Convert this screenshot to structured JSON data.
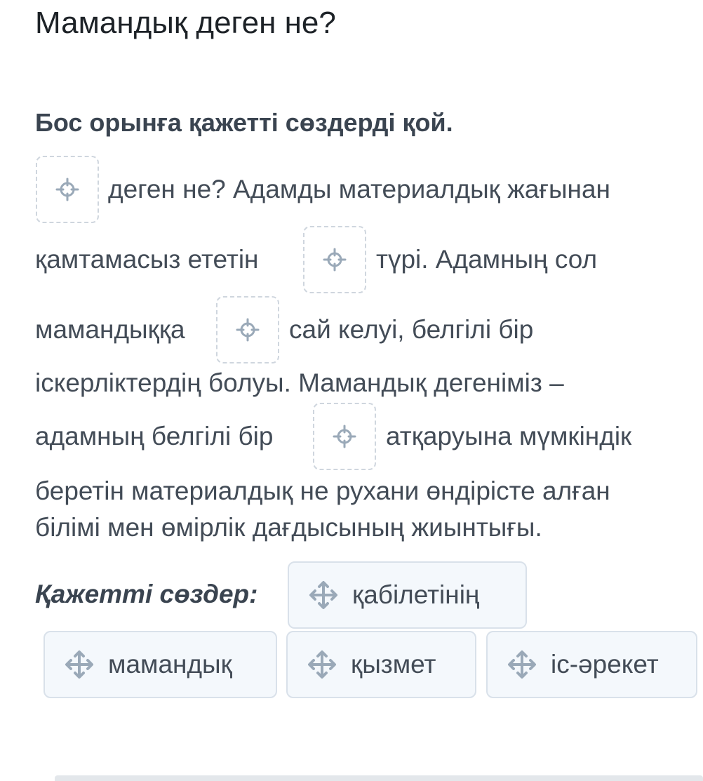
{
  "title": "Мамандық деген не?",
  "instruction": "Бос орынға қажетті сөздерді қой.",
  "text_lines": {
    "l1": "деген не? Адамды материалдық жағынан",
    "l2a": "қамтамасыз ететін",
    "l2b": "түрі. Адамның сол",
    "l3a": "мамандыққа",
    "l3b": "сай келуі, белгілі бір",
    "l4": "іскерліктердің болуы. Мамандық дегеніміз –",
    "l5a": "адамның белгілі бір",
    "l5b": "атқаруына мүмкіндік",
    "l6": "беретін материалдық не рухани өндірісте алған",
    "l7": "білімі мен өмірлік дағдысының жиынтығы."
  },
  "words_label": "Қажетті сөздер:",
  "word_bank": [
    {
      "label": "қабілетінің"
    },
    {
      "label": "мамандық"
    },
    {
      "label": "қызмет"
    },
    {
      "label": "іс-әрекет"
    }
  ],
  "colors": {
    "icon": "#9aa9b8",
    "chip_bg": "#f4f8fc",
    "chip_border": "#d9e1ea",
    "gap_border": "#cfd6de"
  },
  "icons": {
    "gap": "target-icon",
    "chip": "move-icon"
  }
}
